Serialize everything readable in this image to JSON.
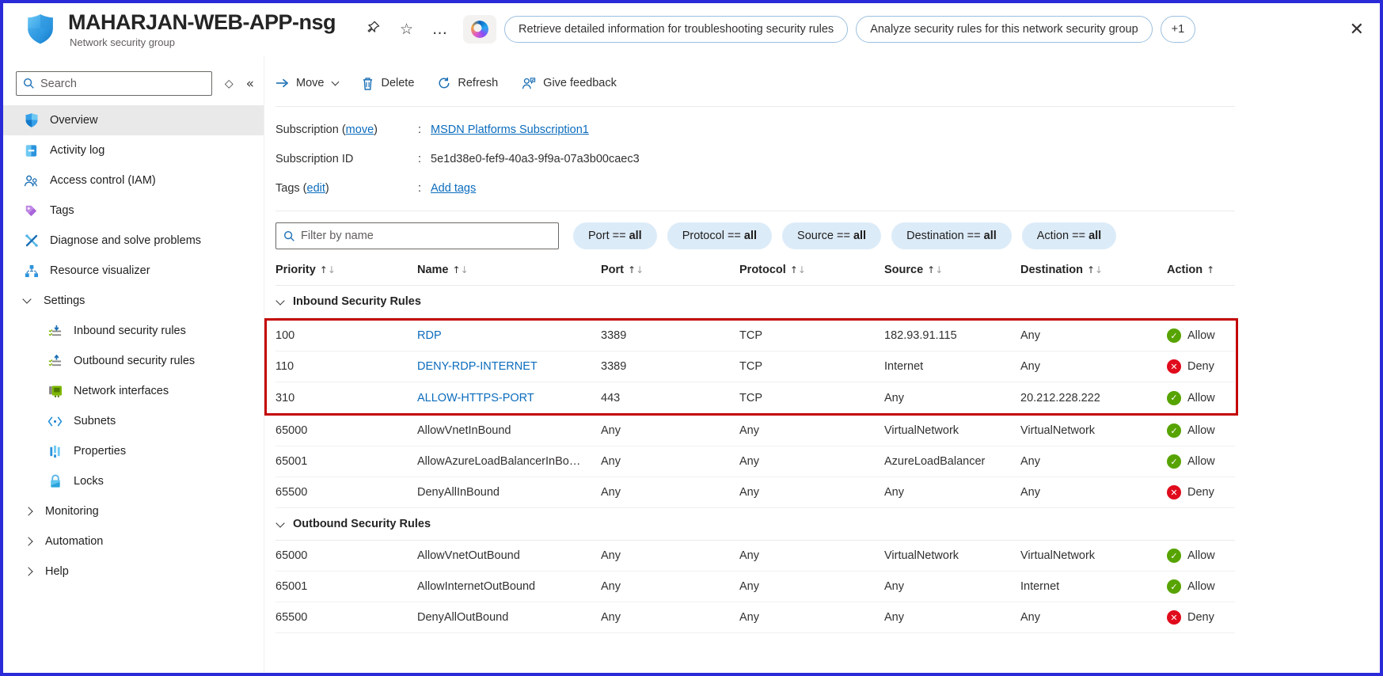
{
  "colors": {
    "allow": "#57a300",
    "deny": "#e00b1c",
    "link": "#0b6cbd",
    "highlight_border": "#c40404",
    "accent": "#0b6cbd"
  },
  "header": {
    "title": "MAHARJAN-WEB-APP-nsg",
    "subtitle": "Network security group",
    "pin_icon": "pin",
    "favorite_icon": "star",
    "more_icon": "…",
    "suggestion_primary": "Retrieve detailed information for troubleshooting security rules",
    "suggestion_secondary": "Analyze security rules for this network security group",
    "more_badge": "+1",
    "close_glyph": "✕"
  },
  "sidebar": {
    "search_placeholder": "Search",
    "expand_glyph": "◇",
    "collapse_glyph": "«",
    "items": [
      {
        "label": "Overview",
        "icon": "overview-shield-icon",
        "selected": true
      },
      {
        "label": "Activity log",
        "icon": "activity-log-icon"
      },
      {
        "label": "Access control (IAM)",
        "icon": "access-control-icon"
      },
      {
        "label": "Tags",
        "icon": "tag-icon"
      },
      {
        "label": "Diagnose and solve problems",
        "icon": "diagnose-icon"
      },
      {
        "label": "Resource visualizer",
        "icon": "resource-visualizer-icon"
      },
      {
        "label": "Settings",
        "chevron": "down",
        "expanded": true
      },
      {
        "label": "Inbound security rules",
        "icon": "inbound-rules-icon",
        "child": true
      },
      {
        "label": "Outbound security rules",
        "icon": "outbound-rules-icon",
        "child": true
      },
      {
        "label": "Network interfaces",
        "icon": "network-interfaces-icon",
        "child": true
      },
      {
        "label": "Subnets",
        "icon": "subnets-icon",
        "child": true
      },
      {
        "label": "Properties",
        "icon": "properties-icon",
        "child": true
      },
      {
        "label": "Locks",
        "icon": "locks-icon",
        "child": true
      },
      {
        "label": "Monitoring",
        "chevron": "right"
      },
      {
        "label": "Automation",
        "chevron": "right"
      },
      {
        "label": "Help",
        "chevron": "right"
      }
    ]
  },
  "toolbar": {
    "move_label": "Move",
    "delete_label": "Delete",
    "refresh_label": "Refresh",
    "feedback_label": "Give feedback"
  },
  "essentials": {
    "colon": ":",
    "paren_open": "(",
    "paren_close": ")",
    "subscription_label": "Subscription ",
    "subscription_move_link": "move",
    "subscription_value": "MSDN Platforms Subscription1",
    "subscription_id_label": "Subscription ID",
    "subscription_id_value": "5e1d38e0-fef9-40a3-9f9a-07a3b00caec3",
    "tags_label": "Tags ",
    "tags_edit_link": "edit",
    "tags_value": "Add tags"
  },
  "filters": {
    "search_placeholder": "Filter by name",
    "pills": [
      {
        "label": "Port == ",
        "value": "all"
      },
      {
        "label": "Protocol == ",
        "value": "all"
      },
      {
        "label": "Source == ",
        "value": "all"
      },
      {
        "label": "Destination == ",
        "value": "all"
      },
      {
        "label": "Action == ",
        "value": "all"
      }
    ]
  },
  "table": {
    "columns": [
      {
        "label": "Priority",
        "sort": "both"
      },
      {
        "label": "Name",
        "sort": "both"
      },
      {
        "label": "Port",
        "sort": "both"
      },
      {
        "label": "Protocol",
        "sort": "both"
      },
      {
        "label": "Source",
        "sort": "both"
      },
      {
        "label": "Destination",
        "sort": "both"
      },
      {
        "label": "Action",
        "sort": "asc"
      }
    ],
    "sections": [
      {
        "title": "Inbound Security Rules",
        "rows": [
          {
            "priority": "100",
            "name": "RDP",
            "link": true,
            "port": "3389",
            "protocol": "TCP",
            "source": "182.93.91.115",
            "destination": "Any",
            "action": "Allow",
            "highlight": true
          },
          {
            "priority": "110",
            "name": "DENY-RDP-INTERNET",
            "link": true,
            "port": "3389",
            "protocol": "TCP",
            "source": "Internet",
            "destination": "Any",
            "action": "Deny",
            "highlight": true
          },
          {
            "priority": "310",
            "name": "ALLOW-HTTPS-PORT",
            "link": true,
            "port": "443",
            "protocol": "TCP",
            "source": "Any",
            "destination": "20.212.228.222",
            "action": "Allow",
            "highlight": true
          },
          {
            "priority": "65000",
            "name": "AllowVnetInBound",
            "link": false,
            "port": "Any",
            "protocol": "Any",
            "source": "VirtualNetwork",
            "destination": "VirtualNetwork",
            "action": "Allow"
          },
          {
            "priority": "65001",
            "name": "AllowAzureLoadBalancerInBo…",
            "link": false,
            "port": "Any",
            "protocol": "Any",
            "source": "AzureLoadBalancer",
            "destination": "Any",
            "action": "Allow"
          },
          {
            "priority": "65500",
            "name": "DenyAllInBound",
            "link": false,
            "port": "Any",
            "protocol": "Any",
            "source": "Any",
            "destination": "Any",
            "action": "Deny"
          }
        ]
      },
      {
        "title": "Outbound Security Rules",
        "rows": [
          {
            "priority": "65000",
            "name": "AllowVnetOutBound",
            "link": false,
            "port": "Any",
            "protocol": "Any",
            "source": "VirtualNetwork",
            "destination": "VirtualNetwork",
            "action": "Allow"
          },
          {
            "priority": "65001",
            "name": "AllowInternetOutBound",
            "link": false,
            "port": "Any",
            "protocol": "Any",
            "source": "Any",
            "destination": "Internet",
            "action": "Allow"
          },
          {
            "priority": "65500",
            "name": "DenyAllOutBound",
            "link": false,
            "port": "Any",
            "protocol": "Any",
            "source": "Any",
            "destination": "Any",
            "action": "Deny"
          }
        ]
      }
    ]
  }
}
